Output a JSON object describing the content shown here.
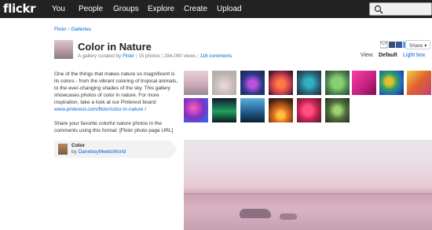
{
  "nav": {
    "logo": "flickr",
    "items": [
      "You",
      "People",
      "Groups",
      "Explore",
      "Create",
      "Upload"
    ]
  },
  "breadcrumb": {
    "parent": "Flickr",
    "separator": "›",
    "current": "Galleries"
  },
  "gallery": {
    "title": "Color in Nature",
    "meta_prefix": "A gallery curated by",
    "curator_link": "Flickr",
    "photo_count": "15 photos",
    "views": "284,090 views",
    "comments": "116 comments",
    "meta_sep": "|"
  },
  "share": {
    "label": "Share",
    "icons": [
      "email-icon",
      "tumblr-icon",
      "facebook-icon",
      "twitter-icon"
    ]
  },
  "view": {
    "label": "View:",
    "default": "Default",
    "lightbox": "Light box"
  },
  "description": {
    "text": "One of the things that makes nature so magnificent is its colors - from the vibrant coloring of tropical animals, to the ever-changing shades of the sky. This gallery showcases photos of color in nature. For more inspiration, take a look at our Pinterest board: ",
    "link": "www.pinterest.com/flickr/color-in-nature /",
    "share_text": "Share your favorite colorful nature photos in the comments using this format: [Flickr photo page URL]"
  },
  "featured": {
    "title": "Color",
    "by": "by",
    "author": "DaneboyMeetsWorld"
  },
  "colors": {
    "nav_bg": "#222222",
    "link": "#0063dc"
  }
}
